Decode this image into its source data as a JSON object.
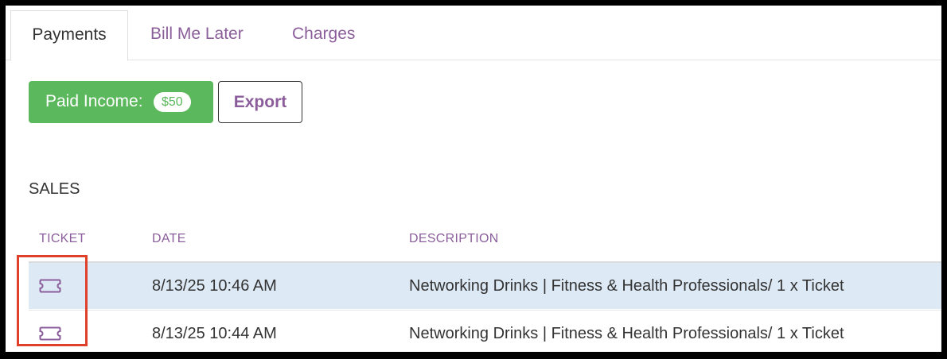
{
  "tabs": [
    {
      "label": "Payments",
      "active": true
    },
    {
      "label": "Bill Me Later",
      "active": false
    },
    {
      "label": "Charges",
      "active": false
    }
  ],
  "actions": {
    "paid_income_label": "Paid Income:",
    "paid_income_value": "$50",
    "export_label": "Export"
  },
  "sales": {
    "heading": "SALES",
    "columns": [
      "TICKET",
      "DATE",
      "DESCRIPTION"
    ],
    "rows": [
      {
        "ticket_icon": "ticket-icon",
        "date": "8/13/25 10:46 AM",
        "description": "Networking Drinks | Fitness & Health Professionals/ 1 x Ticket"
      },
      {
        "ticket_icon": "ticket-icon",
        "date": "8/13/25 10:44 AM",
        "description": "Networking Drinks | Fitness & Health Professionals/ 1 x Ticket"
      }
    ]
  },
  "colors": {
    "accent_purple": "#8b5e9b",
    "success_green": "#5cb85c",
    "row_highlight": "#dde9f4",
    "annotation_red": "#e0402a"
  }
}
